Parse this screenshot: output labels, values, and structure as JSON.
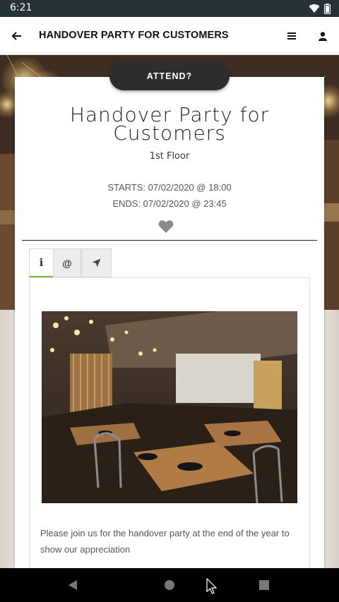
{
  "status_bar": {
    "time": "6:21",
    "icons": [
      "wifi-icon",
      "battery-icon"
    ]
  },
  "app_bar": {
    "title": "HANDOVER PARTY FOR CUSTOMERS",
    "icons": [
      "back-arrow-icon",
      "menu-icon",
      "user-icon"
    ]
  },
  "event": {
    "attend_label": "ATTEND?",
    "title": "Handover Party for Customers",
    "location": "1st Floor",
    "starts": "STARTS: 07/02/2020 @ 18:00",
    "ends": "ENDS: 07/02/2020 @ 23:45",
    "favorite_icon": "heart-icon"
  },
  "tabs": [
    {
      "label": "i",
      "icon": "info-icon",
      "active": true
    },
    {
      "label": "@",
      "icon": "at-icon",
      "active": false
    },
    {
      "label": "",
      "icon": "location-arrow-icon",
      "active": false
    }
  ],
  "info_panel": {
    "description": "Please join us for the handover party at the end of the year to show our appreciation"
  },
  "nav_bar": {
    "icons": [
      "back-icon",
      "home-icon",
      "recents-icon"
    ]
  },
  "colors": {
    "status_bar": "#263238",
    "attend_button": "#2d2d2d",
    "active_tab_underline": "#7cb342",
    "heart": "#8a8a8a"
  }
}
